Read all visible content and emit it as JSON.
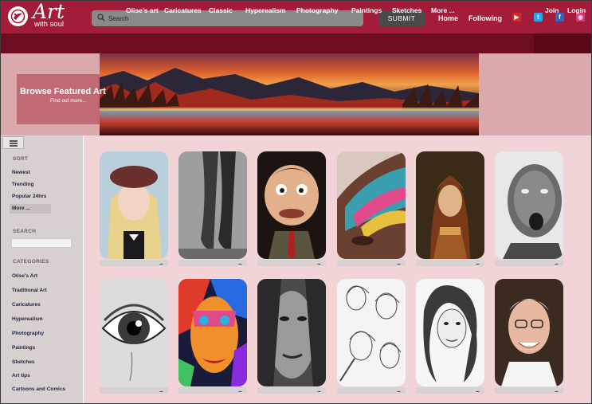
{
  "header": {
    "logo_title": "Art",
    "logo_subtitle": "with soul",
    "search_placeholder": "Search",
    "submit_label": "SUBMIT",
    "links": [
      "Home",
      "Following"
    ],
    "social_icons": [
      "youtube-icon",
      "twitter-icon",
      "facebook-icon",
      "instagram-icon"
    ],
    "brand_color": "#a31d3a"
  },
  "nav": {
    "items": [
      "Olise's art",
      "Caricatures",
      "Classic",
      "Hyperealism",
      "Photography",
      "Paintings",
      "Sketches",
      "More ..."
    ],
    "auth": [
      "Join",
      "Login"
    ],
    "color": "#6e0d22"
  },
  "banner": {
    "title": "Browse Featured Art",
    "subtitle": "Find out more..."
  },
  "sidebar": {
    "sort_heading": "SORT",
    "sort_items": [
      "Newest",
      "Trending",
      "Popular 24hrs",
      "More ..."
    ],
    "search_heading": "SEARCH",
    "categories_heading": "CATEGORIES",
    "categories": [
      "Olise's Art",
      "Traditional Art",
      "Caricatures",
      "Hyperealism",
      "Photography",
      "Paintings",
      "Sketches",
      "Art tips",
      "Cartoons and Comics"
    ]
  },
  "grid": {
    "card_menu_label": "...",
    "rows": [
      [
        "girl-portrait-image",
        "ballet-feet-sketch-image",
        "caricature-comedian-image",
        "painted-face-image",
        "renaissance-portrait-image",
        "pencil-face-drawing-image"
      ],
      [
        "eye-drawing-image",
        "colorful-face-painting-image",
        "wet-face-drawing-image",
        "figure-sketches-image",
        "woman-sketch-image",
        "elderly-man-caricature-image"
      ]
    ]
  }
}
